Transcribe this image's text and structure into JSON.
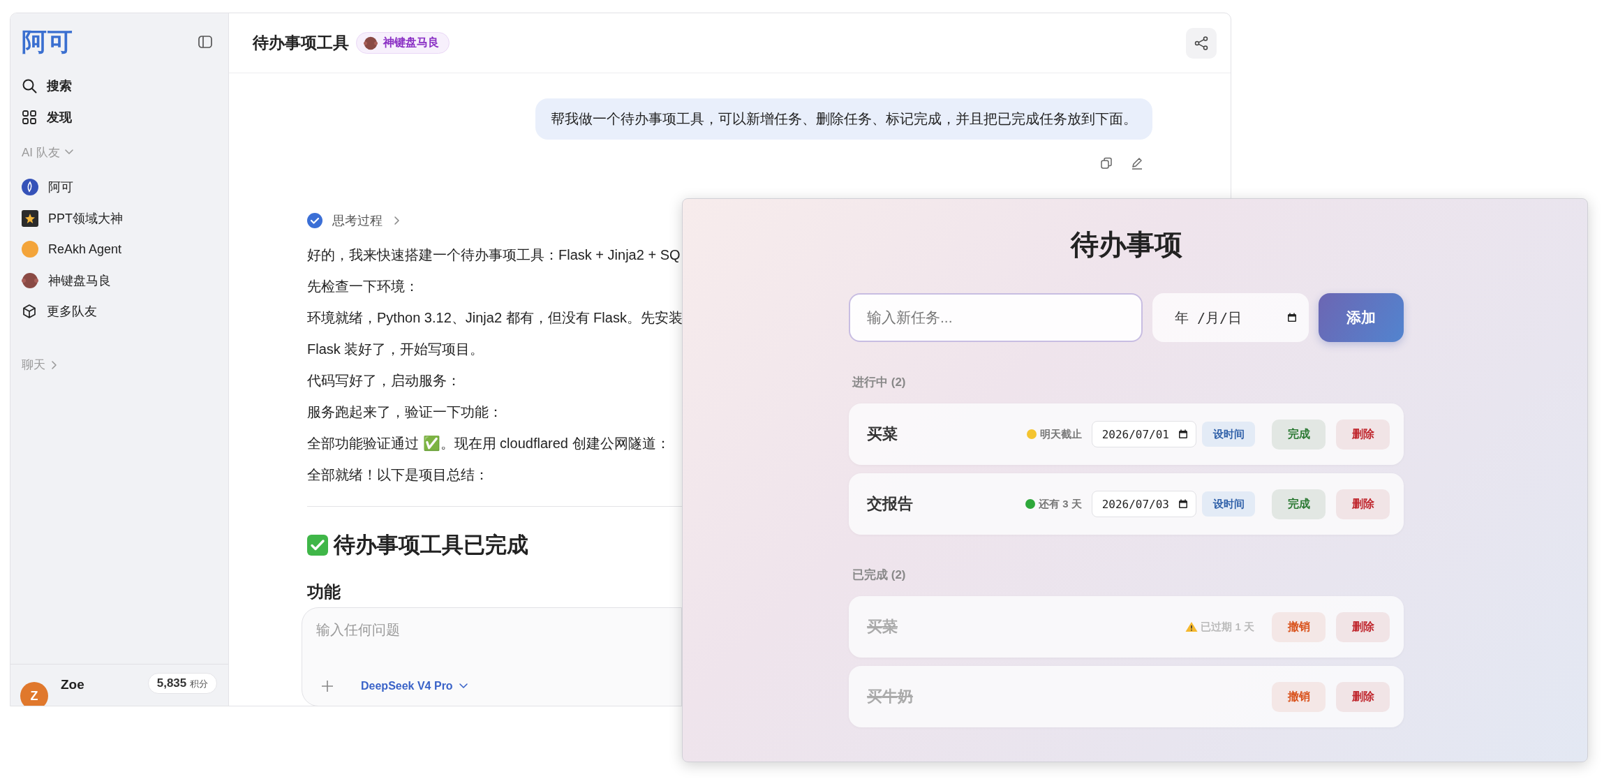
{
  "sidebar": {
    "logo": "阿可",
    "nav": [
      {
        "label": "搜索"
      },
      {
        "label": "发现"
      }
    ],
    "teammates_header": "AI 队友",
    "teammates": [
      {
        "label": "阿可"
      },
      {
        "label": "PPT领域大神"
      },
      {
        "label": "ReAkh Agent"
      },
      {
        "label": "神键盘马良"
      },
      {
        "label": "更多队友"
      }
    ],
    "chats_header": "聊天",
    "user": {
      "initial": "Z",
      "name": "Zoe",
      "points": "5,835",
      "points_unit": "积分"
    }
  },
  "header": {
    "title": "待办事项工具",
    "agent": "神键盘马良"
  },
  "chat": {
    "user_message": "帮我做一个待办事项工具，可以新增任务、删除任务、标记完成，并且把已完成任务放到下面。",
    "thinking": "思考过程",
    "paragraphs": [
      "好的，我来快速搭建一个待办事项工具：Flask + Jinja2 + SQ",
      "先检查一下环境：",
      "环境就绪，Python 3.12、Jinja2 都有，但没有 Flask。先安装",
      "Flask 装好了，开始写项目。",
      "代码写好了，启动服务：",
      "服务跑起来了，验证一下功能：",
      "全部功能验证通过 ✅。现在用 cloudflared 创建公网隧道：",
      "全部就绪！以下是项目总结："
    ],
    "heading": "待办事项工具已完成",
    "subheading": "功能",
    "composer": {
      "placeholder": "输入任何问题",
      "model": "DeepSeek V4 Pro"
    }
  },
  "todo_app": {
    "title": "待办事项",
    "task_input": {
      "placeholder": "输入新任务..."
    },
    "date_input": {
      "placeholder": "年 /月/日"
    },
    "add_button": "添加",
    "sections": [
      {
        "title": "进行中 (2)",
        "tasks": [
          {
            "name": "买菜",
            "done": false,
            "due": {
              "kind": "dot",
              "color": "#f4c430",
              "text": "明天截止"
            },
            "date": "2026/07/01",
            "set_time": "设时间",
            "actions": [
              {
                "label": "完成",
                "kind": "complete"
              },
              {
                "label": "删除",
                "kind": "delete"
              }
            ]
          },
          {
            "name": "交报告",
            "done": false,
            "due": {
              "kind": "dot",
              "color": "#2ea83a",
              "text": "还有 3 天"
            },
            "date": "2026/07/03",
            "set_time": "设时间",
            "actions": [
              {
                "label": "完成",
                "kind": "complete"
              },
              {
                "label": "删除",
                "kind": "delete"
              }
            ]
          }
        ]
      },
      {
        "title": "已完成 (2)",
        "tasks": [
          {
            "name": "买菜",
            "done": true,
            "due": {
              "kind": "warning",
              "text": "已过期 1 天"
            },
            "actions": [
              {
                "label": "撤销",
                "kind": "undo"
              },
              {
                "label": "删除",
                "kind": "delete"
              }
            ]
          },
          {
            "name": "买牛奶",
            "done": true,
            "actions": [
              {
                "label": "撤销",
                "kind": "undo"
              },
              {
                "label": "删除",
                "kind": "delete"
              }
            ]
          }
        ]
      }
    ]
  }
}
